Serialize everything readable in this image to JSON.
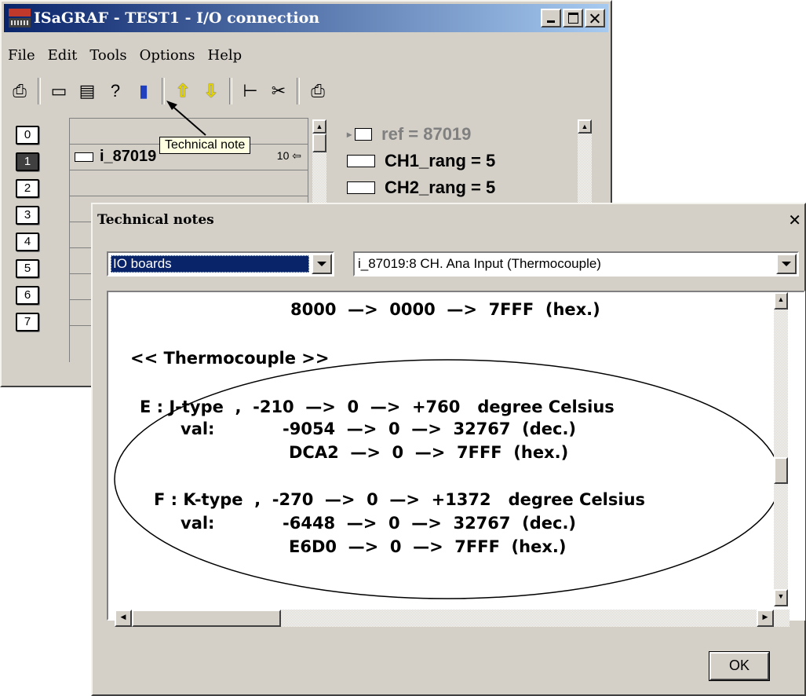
{
  "main_window": {
    "title": "ISaGRAF - TEST1 - I/O connection",
    "menu": [
      "File",
      "Edit",
      "Tools",
      "Options",
      "Help"
    ],
    "toolbar_icons": [
      "open-icon",
      "board-icon",
      "edit-board-icon",
      "technical-note-icon",
      "delete-icon",
      "move-up-icon",
      "move-down-icon",
      "tree-icon",
      "cut-icon",
      "print-icon"
    ],
    "slots": [
      "0",
      "1",
      "2",
      "3",
      "4",
      "5",
      "6",
      "7"
    ],
    "active_slot": "1",
    "board_name": "i_87019",
    "board_tail": "10 ⇦",
    "variables": [
      {
        "text": "ref = 87019",
        "muted": true
      },
      {
        "text": "CH1_rang = 5",
        "muted": false
      },
      {
        "text": "CH2_rang = 5",
        "muted": false
      }
    ]
  },
  "tooltip": {
    "text": "Technical note"
  },
  "dialog": {
    "title": "Technical notes",
    "category": "IO boards",
    "board": "i_87019:8 CH. Ana Input (Thermocouple)",
    "notes_lines": [
      "8000  —>  0000  —>  7FFF  (hex.)",
      "<< Thermocouple >>",
      "E : J-type  ,  -210  —>  0  —>  +760   degree Celsius",
      "val:",
      "-9054  —>  0  —>  32767  (dec.)",
      "DCA2  —>  0  —>  7FFF  (hex.)",
      "F : K-type  ,  -270  —>  0  —>  +1372   degree Celsius",
      "val:",
      "-6448  —>  0  —>  32767  (dec.)",
      "E6D0  —>  0  —>  7FFF  (hex.)"
    ],
    "ok_label": "OK"
  }
}
